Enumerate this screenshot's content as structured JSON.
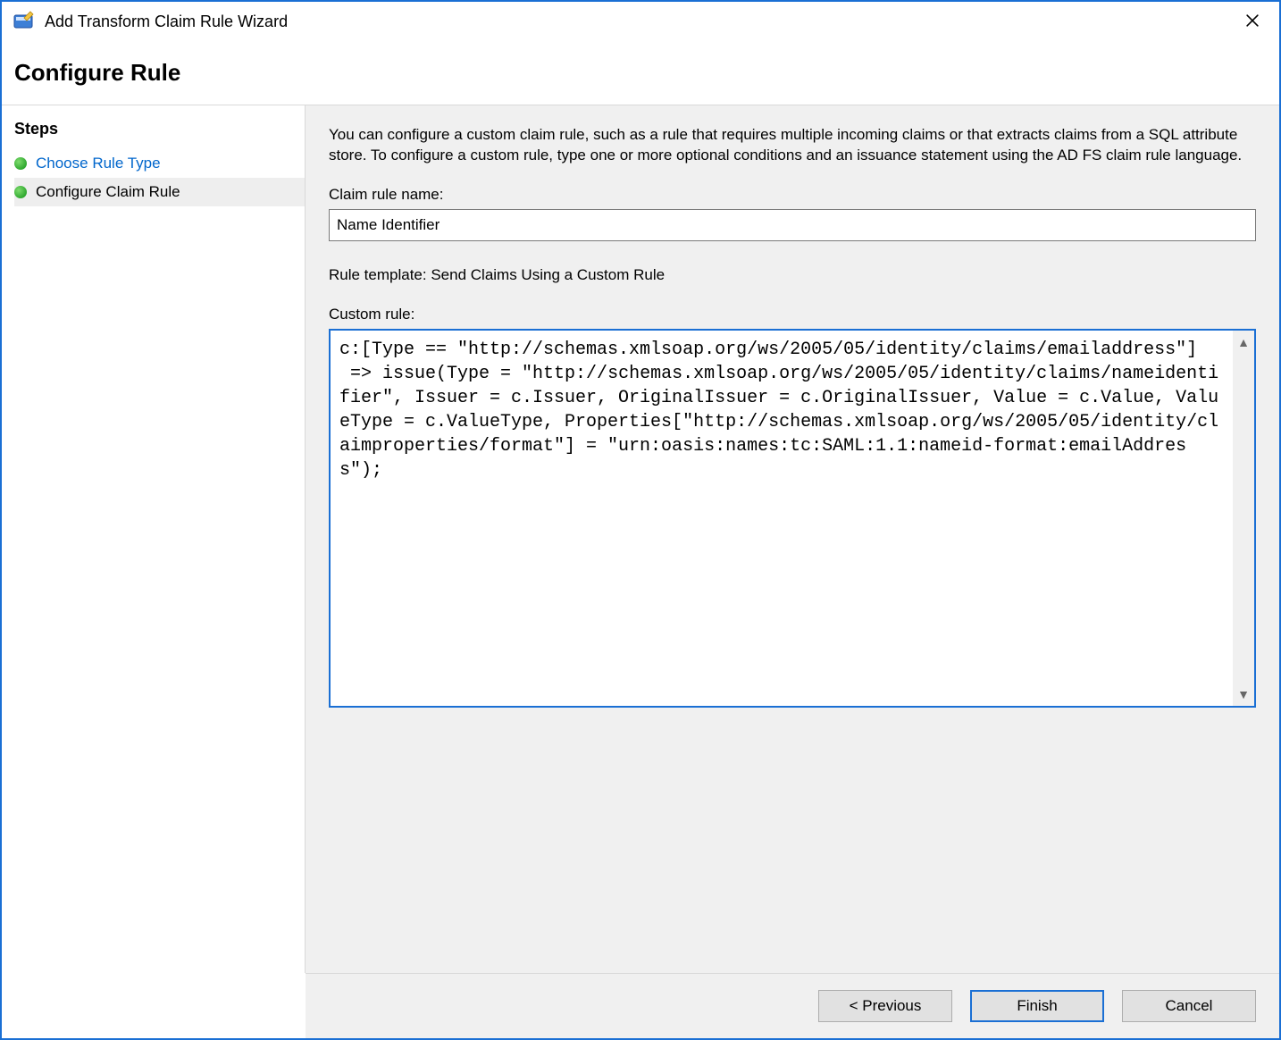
{
  "titlebar": {
    "title": "Add Transform Claim Rule Wizard"
  },
  "header": {
    "heading": "Configure Rule"
  },
  "steps": {
    "heading": "Steps",
    "items": [
      {
        "label": "Choose Rule Type",
        "link": true,
        "current": false
      },
      {
        "label": "Configure Claim Rule",
        "link": false,
        "current": true
      }
    ]
  },
  "content": {
    "intro": "You can configure a custom claim rule, such as a rule that requires multiple incoming claims or that extracts claims from a SQL attribute store. To configure a custom rule, type one or more optional conditions and an issuance statement using the AD FS claim rule language.",
    "claim_rule_name_label": "Claim rule name:",
    "claim_rule_name_value": "Name Identifier",
    "rule_template_label": "Rule template: Send Claims Using a Custom Rule",
    "custom_rule_label": "Custom rule:",
    "custom_rule_value": "c:[Type == \"http://schemas.xmlsoap.org/ws/2005/05/identity/claims/emailaddress\"]\n => issue(Type = \"http://schemas.xmlsoap.org/ws/2005/05/identity/claims/nameidentifier\", Issuer = c.Issuer, OriginalIssuer = c.OriginalIssuer, Value = c.Value, ValueType = c.ValueType, Properties[\"http://schemas.xmlsoap.org/ws/2005/05/identity/claimproperties/format\"] = \"urn:oasis:names:tc:SAML:1.1:nameid-format:emailAddress\");"
  },
  "footer": {
    "previous": "< Previous",
    "finish": "Finish",
    "cancel": "Cancel"
  }
}
